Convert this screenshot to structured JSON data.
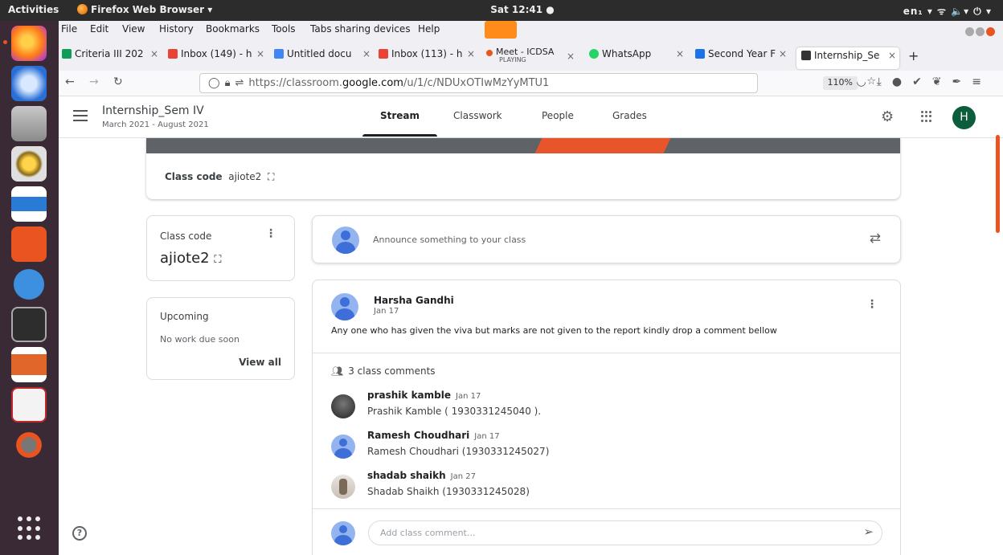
{
  "system": {
    "activities": "Activities",
    "app_name": "Firefox Web Browser ▾",
    "clock": "Sat 12:41 ●",
    "tray": "en₁ ▾   ᯤ  🔈▾  ⏻ ▾"
  },
  "menu": [
    "File",
    "Edit",
    "View",
    "History",
    "Bookmarks",
    "Tools",
    "Tabs sharing devices",
    "Help"
  ],
  "tabs": [
    {
      "label": "Criteria III 202",
      "color": "#0f9d58"
    },
    {
      "label": "Inbox (149) - h",
      "color": "#ea4335"
    },
    {
      "label": "Untitled docu",
      "color": "#4285f4"
    },
    {
      "label": "Inbox (113) - h",
      "color": "#ea4335"
    },
    {
      "label": "Meet - ICDSA",
      "sub": "PLAYING",
      "color": "#e95420"
    },
    {
      "label": "WhatsApp",
      "color": "#25d366"
    },
    {
      "label": "Second Year F",
      "color": "#1a73e8"
    },
    {
      "label": "Internship_Se",
      "color": "#333333"
    }
  ],
  "url": {
    "prefix": "https://classroom.",
    "host": "google.com",
    "path": "/u/1/c/NDUxOTIwMzYyMTU1",
    "zoom": "110%"
  },
  "classroom": {
    "title": "Internship_Sem IV",
    "subtitle": "March 2021 - August 2021",
    "nav": [
      "Stream",
      "Classwork",
      "People",
      "Grades"
    ],
    "avatar_letter": "H",
    "banner_label": "Class code",
    "banner_code": "ajiote2",
    "code_card": {
      "title": "Class code",
      "code": "ajiote2"
    },
    "upcoming": {
      "title": "Upcoming",
      "note": "No work due soon",
      "link": "View all"
    },
    "announce_placeholder": "Announce something to your class",
    "post": {
      "author": "Harsha Gandhi",
      "date": "Jan 17",
      "body": "Any one who has given the viva but marks are not given to the report kindly drop a comment bellow",
      "comment_count": "3 class comments",
      "comments": [
        {
          "name": "prashik kamble",
          "date": "Jan 17",
          "text": "Prashik Kamble ( 1930331245040 )."
        },
        {
          "name": "Ramesh Choudhari",
          "date": "Jan 17",
          "text": "Ramesh Choudhari (1930331245027)"
        },
        {
          "name": "shadab shaikh",
          "date": "Jan 27",
          "text": "Shadab Shaikh (1930331245028)"
        }
      ],
      "add_placeholder": "Add class comment..."
    }
  },
  "colors": {
    "ubuntu_orange": "#e95420",
    "classroom_green": "#0b5d3b"
  }
}
